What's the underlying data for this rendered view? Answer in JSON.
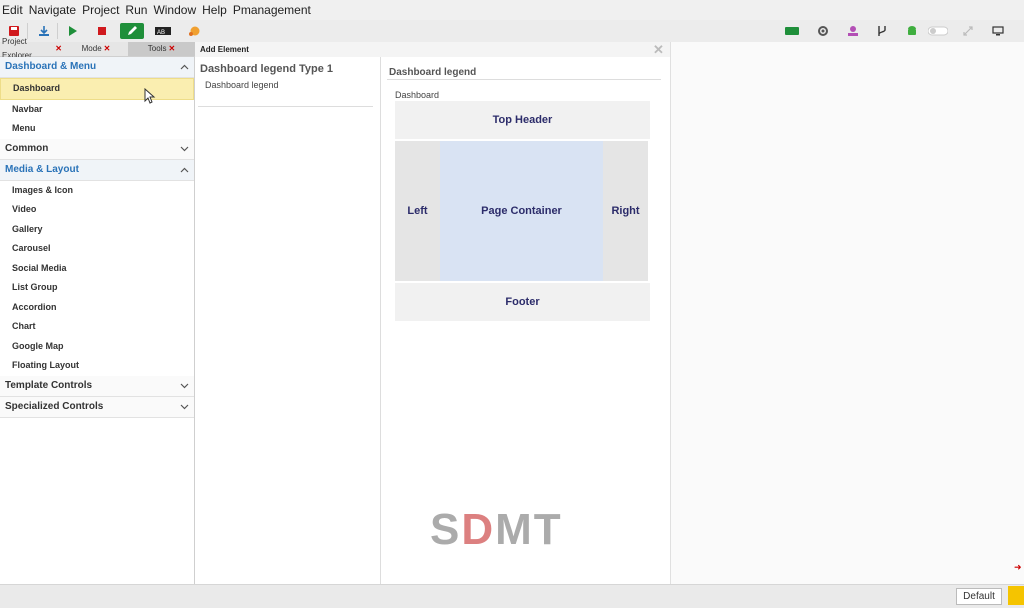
{
  "menu": [
    "Edit",
    "Navigate",
    "Project",
    "Run",
    "Window",
    "Help",
    "Pmanagement"
  ],
  "toolbar_icons_left": [
    "save-icon",
    "download-icon",
    "run-icon",
    "stop-icon",
    "edit-icon",
    "ab-icon",
    "paint-icon"
  ],
  "toolbar_icons_right": [
    "chat-icon",
    "settings-icon",
    "user-icon",
    "branch-icon",
    "android-icon",
    "toggle-icon",
    "expand-icon",
    "monitor-icon"
  ],
  "tabs": [
    {
      "label": "Project Explorer",
      "active": false
    },
    {
      "label": "Mode",
      "active": false
    },
    {
      "label": "Tools",
      "active": true
    }
  ],
  "add_element_title": "Add Element",
  "close_glyph": "✕",
  "sections": [
    {
      "label": "Dashboard & Menu",
      "open": true,
      "items": [
        "Dashboard",
        "Navbar",
        "Menu"
      ],
      "selected": "Dashboard"
    },
    {
      "label": "Common",
      "open": false,
      "items": []
    },
    {
      "label": "Media & Layout",
      "open": true,
      "items": [
        "Images & Icon",
        "Video",
        "Gallery",
        "Carousel",
        "Social Media",
        "List Group",
        "Accordion",
        "Chart",
        "Google Map",
        "Floating Layout"
      ]
    },
    {
      "label": "Template Controls",
      "open": false,
      "items": []
    },
    {
      "label": "Specialized Controls",
      "open": false,
      "items": []
    }
  ],
  "middle": {
    "title": "Dashboard legend Type 1",
    "item": "Dashboard legend"
  },
  "preview": {
    "title": "Dashboard legend",
    "subtitle": "Dashboard",
    "top": "Top Header",
    "left": "Left",
    "center": "Page Container",
    "right": "Right",
    "footer": "Footer"
  },
  "watermark": {
    "part1": "S",
    "part2": "D",
    "part3": "MT"
  },
  "status": {
    "default_label": "Default"
  },
  "colors": {
    "accent_blue": "#2a73b8",
    "selected_row": "#faeeb0",
    "layout_text": "#2c2c6a",
    "page_container": "#d9e3f3"
  }
}
